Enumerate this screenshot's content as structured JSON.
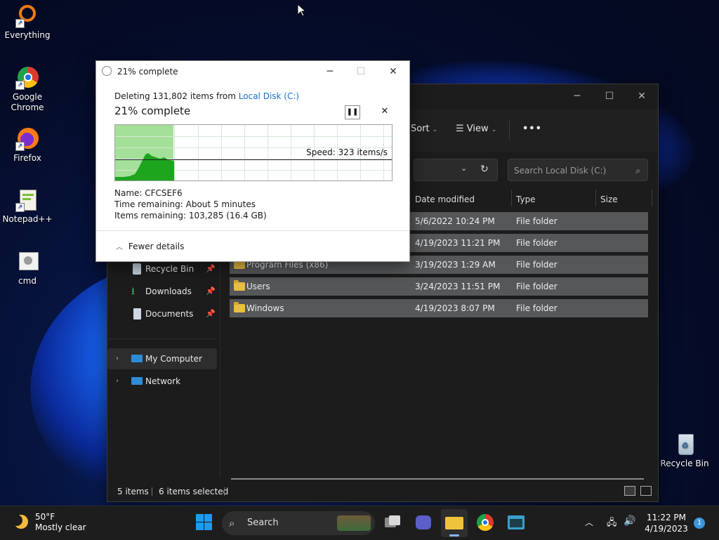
{
  "desktop": {
    "icons": [
      {
        "label": "Everything"
      },
      {
        "label": "Google Chrome"
      },
      {
        "label": "Firefox"
      },
      {
        "label": "Notepad++"
      },
      {
        "label": "cmd"
      },
      {
        "label": "Recycle Bin"
      }
    ]
  },
  "explorer": {
    "toolbar": {
      "sort_label": "Sort",
      "view_label": "View",
      "more_label": "•••"
    },
    "search_placeholder": "Search Local Disk (C:)",
    "nav": {
      "quick": [
        {
          "label": "Recycle Bin"
        },
        {
          "label": "Downloads"
        },
        {
          "label": "Documents"
        }
      ],
      "tree": [
        {
          "label": "My Computer"
        },
        {
          "label": "Network"
        }
      ]
    },
    "columns": [
      "Date modified",
      "Type",
      "Size"
    ],
    "rows": [
      {
        "name": "",
        "date": "5/6/2022 10:24 PM",
        "type": "File folder"
      },
      {
        "name": "",
        "date": "4/19/2023 11:21 PM",
        "type": "File folder"
      },
      {
        "name": "Program Files (x86)",
        "date": "3/19/2023 1:29 AM",
        "type": "File folder"
      },
      {
        "name": "Users",
        "date": "3/24/2023 11:51 PM",
        "type": "File folder"
      },
      {
        "name": "Windows",
        "date": "4/19/2023 8:07 PM",
        "type": "File folder"
      }
    ],
    "status": {
      "items": "5 items",
      "selected": "6 items selected"
    }
  },
  "dialog": {
    "title": "21% complete",
    "deleting_prefix": "Deleting 131,802 items from ",
    "location": "Local Disk (C:)",
    "heading": "21% complete",
    "progress_fraction": 0.21,
    "speed": "Speed: 323 items/s",
    "name": "Name:  CFCSEF6",
    "time_remaining": "Time remaining:  About 5 minutes",
    "items_remaining": "Items remaining:  103,285 (16.4 GB)",
    "fewer_details": "Fewer details",
    "fill_color": "#a4e09a",
    "graph_color": "#1ea51e"
  },
  "taskbar": {
    "weather_temp": "50°F",
    "weather_desc": "Mostly clear",
    "search_label": "Search",
    "time": "11:22 PM",
    "date": "4/19/2023",
    "notification_count": "1"
  },
  "colors": {
    "accent": "#1a6fd1",
    "link": "#1a6fd1",
    "taskbar": "#1d1d1d",
    "row_selected": "#555759"
  }
}
